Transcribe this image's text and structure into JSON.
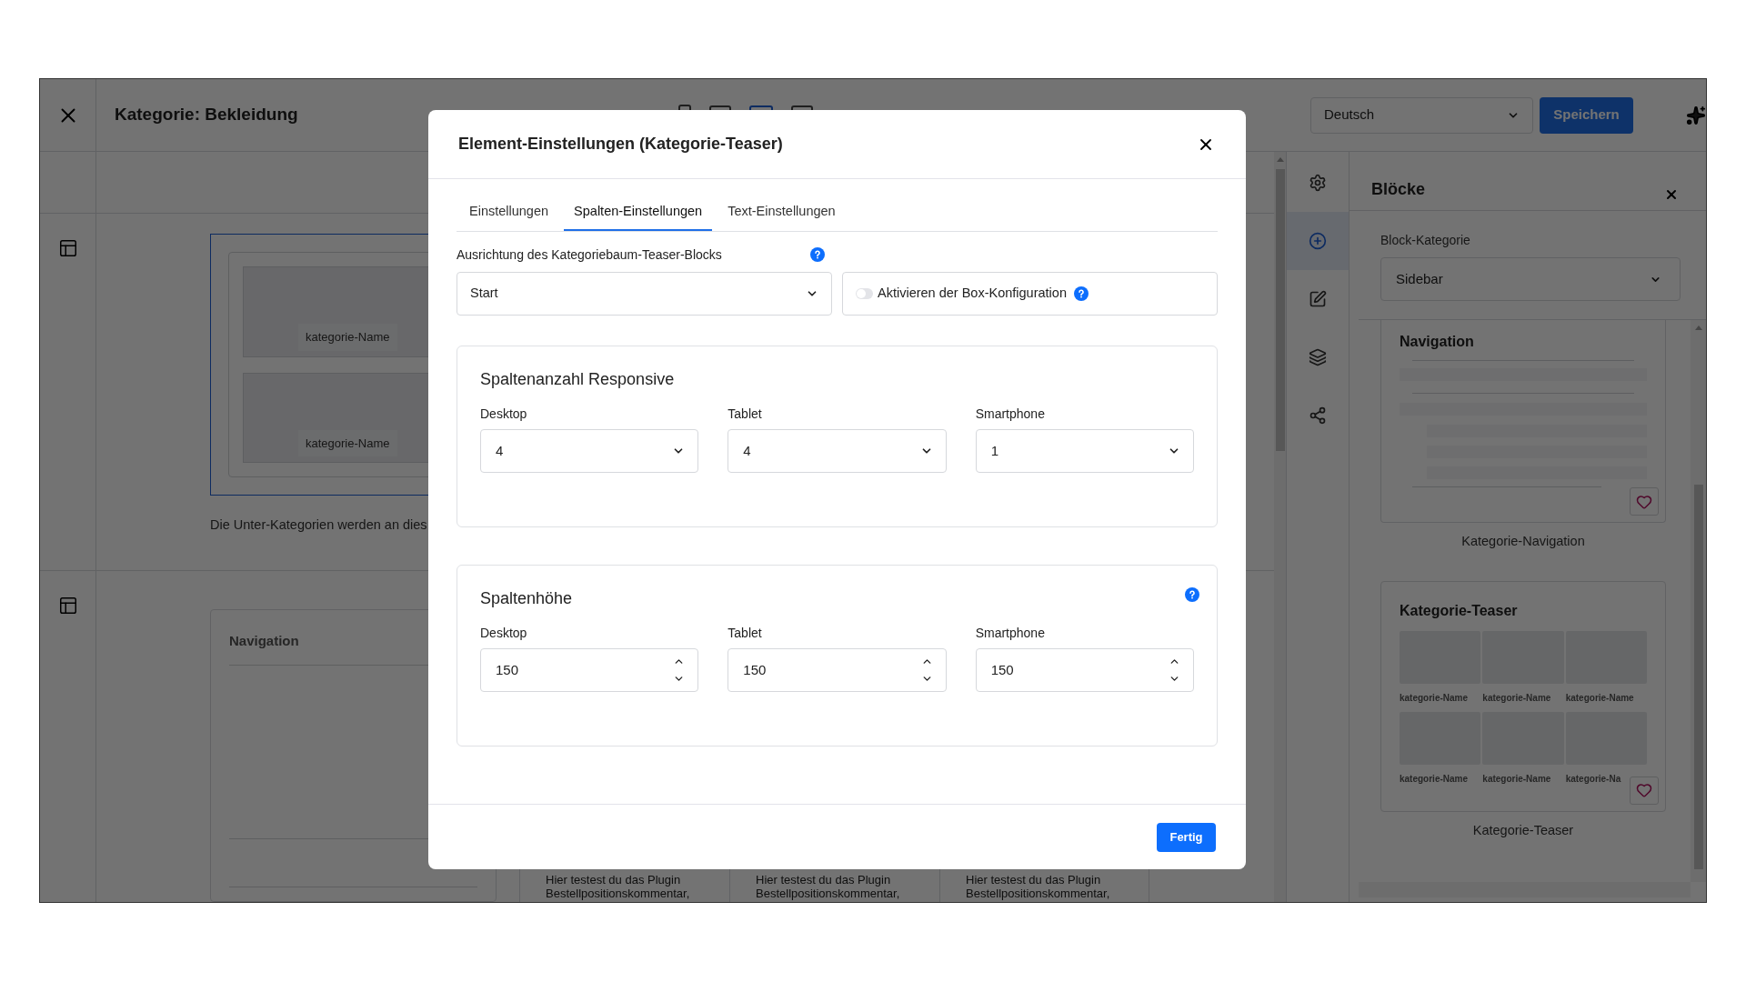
{
  "header": {
    "title": "Kategorie: Bekleidung",
    "language": "Deutsch",
    "save": "Speichern"
  },
  "view_modes": [
    {
      "kind": "smartphone",
      "selected": false
    },
    {
      "kind": "tablet",
      "selected": false
    },
    {
      "kind": "laptop",
      "selected": true
    },
    {
      "kind": "desktop",
      "selected": false
    }
  ],
  "canvas": {
    "teaser_labels": [
      "kategorie-Name",
      "kategorie-Name"
    ],
    "note": "Die Unter-Kategorien werden an dies",
    "navigation_title": "Navigation",
    "product_texts": [
      "Hier testest du das Plugin Bestellpositionskommentar,",
      "Hier testest du das Plugin Bestellpositionskommentar,",
      "Hier testest du das Plugin Bestellpositionskommentar,"
    ]
  },
  "tools": [
    {
      "kind": "settings",
      "selected": false
    },
    {
      "kind": "add",
      "selected": true
    },
    {
      "kind": "edit",
      "selected": false
    },
    {
      "kind": "layers",
      "selected": false
    },
    {
      "kind": "share",
      "selected": false
    }
  ],
  "blocks_panel": {
    "title": "Blöcke",
    "category_label": "Block-Kategorie",
    "category": "Sidebar",
    "blocks": [
      {
        "kind": "navigation",
        "heading": "Navigation",
        "caption": "Kategorie-Navigation"
      },
      {
        "kind": "teaser",
        "heading": "Kategorie-Teaser",
        "labels": [
          "kategorie-Name",
          "kategorie-Name",
          "kategorie-Name",
          "kategorie-Name",
          "kategorie-Name",
          "kategorie-Na"
        ],
        "caption": "Kategorie-Teaser"
      }
    ]
  },
  "dialog": {
    "title": "Element-Einstellungen (Kategorie-Teaser)",
    "tabs": [
      {
        "label": "Einstellungen",
        "selected": false
      },
      {
        "label": "Spalten-Einstellungen",
        "selected": true
      },
      {
        "label": "Text-Einstellungen",
        "selected": false
      }
    ],
    "alignment": {
      "label": "Ausrichtung des Kategoriebaum-Teaser-Blocks",
      "value": "Start"
    },
    "box_config": {
      "label": "Aktivieren der Box-Konfiguration",
      "on": false
    },
    "column_count": {
      "title": "Spaltenanzahl Responsive",
      "fields": [
        {
          "label": "Desktop",
          "value": "4"
        },
        {
          "label": "Tablet",
          "value": "4"
        },
        {
          "label": "Smartphone",
          "value": "1"
        }
      ]
    },
    "column_height": {
      "title": "Spaltenhöhe",
      "fields": [
        {
          "label": "Desktop",
          "value": "150"
        },
        {
          "label": "Tablet",
          "value": "150"
        },
        {
          "label": "Smartphone",
          "value": "150"
        }
      ]
    },
    "done": "Fertig"
  }
}
